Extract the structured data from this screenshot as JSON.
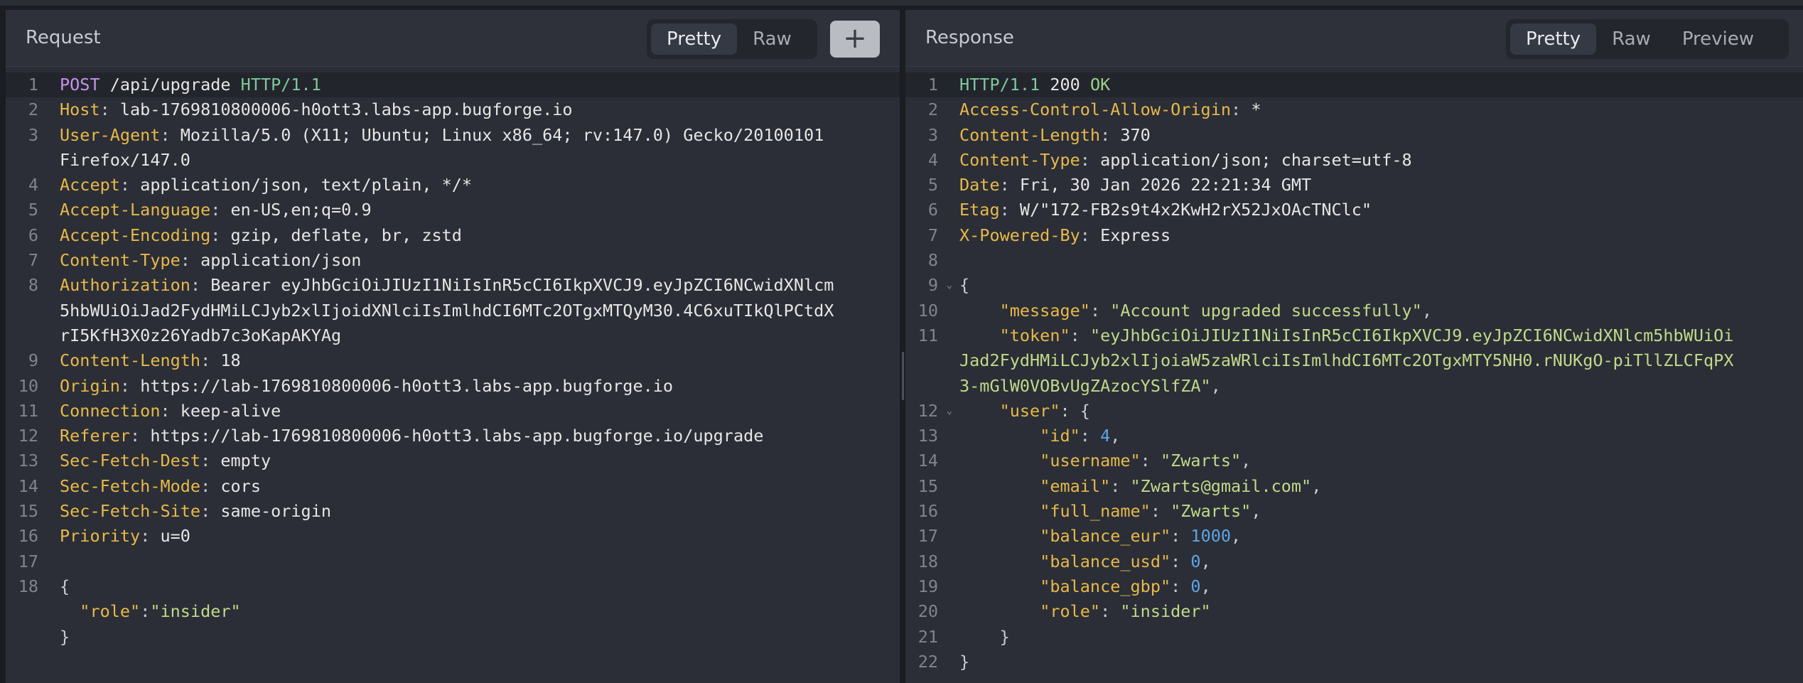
{
  "request": {
    "title": "Request",
    "tabs": [
      "Pretty",
      "Raw"
    ],
    "active_tab": "Pretty",
    "add_label": "+",
    "lines": [
      {
        "n": "1",
        "method": "POST",
        "path": " /api/upgrade ",
        "version": "HTTP/1.1"
      },
      {
        "n": "2",
        "key": "Host",
        "value": "lab-1769810800006-h0ott3.labs-app.bugforge.io"
      },
      {
        "n": "3",
        "key": "User-Agent",
        "value": "Mozilla/5.0 (X11; Ubuntu; Linux x86_64; rv:147.0) Gecko/20100101"
      },
      {
        "n": "",
        "cont": "Firefox/147.0"
      },
      {
        "n": "4",
        "key": "Accept",
        "value": "application/json, text/plain, */*"
      },
      {
        "n": "5",
        "key": "Accept-Language",
        "value": "en-US,en;q=0.9"
      },
      {
        "n": "6",
        "key": "Accept-Encoding",
        "value": "gzip, deflate, br, zstd"
      },
      {
        "n": "7",
        "key": "Content-Type",
        "value": "application/json"
      },
      {
        "n": "8",
        "key": "Authorization",
        "value": "Bearer eyJhbGciOiJIUzI1NiIsInR5cCI6IkpXVCJ9.eyJpZCI6NCwidXNlcm"
      },
      {
        "n": "",
        "cont": "5hbWUiOiJad2FydHMiLCJyb2xlIjoidXNlciIsImlhdCI6MTc2OTgxMTQyM30.4C6xuTIkQlPCtdX"
      },
      {
        "n": "",
        "cont": "rI5KfH3X0z26Yadb7c3oKapAKYAg"
      },
      {
        "n": "9",
        "key": "Content-Length",
        "value": "18"
      },
      {
        "n": "10",
        "key": "Origin",
        "value": "https://lab-1769810800006-h0ott3.labs-app.bugforge.io"
      },
      {
        "n": "11",
        "key": "Connection",
        "value": "keep-alive"
      },
      {
        "n": "12",
        "key": "Referer",
        "value": "https://lab-1769810800006-h0ott3.labs-app.bugforge.io/upgrade"
      },
      {
        "n": "13",
        "key": "Sec-Fetch-Dest",
        "value": "empty"
      },
      {
        "n": "14",
        "key": "Sec-Fetch-Mode",
        "value": "cors"
      },
      {
        "n": "15",
        "key": "Sec-Fetch-Site",
        "value": "same-origin"
      },
      {
        "n": "16",
        "key": "Priority",
        "value": "u=0"
      },
      {
        "n": "17",
        "raw": ""
      },
      {
        "n": "18",
        "raw": "{"
      },
      {
        "n": "",
        "body": [
          {
            "t": "  "
          },
          {
            "c": "jk",
            "t": "\"role\""
          },
          {
            "c": "p",
            "t": ":"
          },
          {
            "c": "js",
            "t": "\"insider\""
          }
        ]
      },
      {
        "n": "",
        "raw": "}"
      }
    ]
  },
  "response": {
    "title": "Response",
    "tabs": [
      "Pretty",
      "Raw",
      "Preview"
    ],
    "active_tab": "Pretty",
    "lines": [
      {
        "n": "1",
        "status": [
          {
            "c": "ver",
            "t": "HTTP/1.1"
          },
          {
            "c": "p",
            "t": " "
          },
          {
            "c": "nm-l",
            "t": "200"
          },
          {
            "c": "p",
            "t": " "
          },
          {
            "c": "st",
            "t": "OK"
          }
        ]
      },
      {
        "n": "2",
        "key": "Access-Control-Allow-Origin",
        "value": "*"
      },
      {
        "n": "3",
        "key": "Content-Length",
        "value": "370"
      },
      {
        "n": "4",
        "key": "Content-Type",
        "value": "application/json; charset=utf-8"
      },
      {
        "n": "5",
        "key": "Date",
        "value": "Fri, 30 Jan 2026 22:21:34 GMT"
      },
      {
        "n": "6",
        "key": "Etag",
        "value": "W/\"172-FB2s9t4x2KwH2rX52JxOAcTNClc\""
      },
      {
        "n": "7",
        "key": "X-Powered-By",
        "value": "Express"
      },
      {
        "n": "8",
        "raw": ""
      },
      {
        "n": "9",
        "fold": true,
        "raw": "{"
      },
      {
        "n": "10",
        "body": [
          {
            "t": "    "
          },
          {
            "c": "jk",
            "t": "\"message\""
          },
          {
            "c": "p",
            "t": ": "
          },
          {
            "c": "js",
            "t": "\"Account upgraded successfully\""
          },
          {
            "c": "p",
            "t": ","
          }
        ]
      },
      {
        "n": "11",
        "body": [
          {
            "t": "    "
          },
          {
            "c": "jk",
            "t": "\"token\""
          },
          {
            "c": "p",
            "t": ": "
          },
          {
            "c": "js",
            "t": "\"eyJhbGciOiJIUzI1NiIsInR5cCI6IkpXVCJ9.eyJpZCI6NCwidXNlcm5hbWUiOi"
          }
        ]
      },
      {
        "n": "",
        "body": [
          {
            "c": "js",
            "t": "Jad2FydHMiLCJyb2xlIjoiaW5zaWRlciIsImlhdCI6MTc2OTgxMTY5NH0.rNUKgO-piTllZLCFqPX"
          }
        ]
      },
      {
        "n": "",
        "body": [
          {
            "c": "js",
            "t": "3-mGlW0VOBvUgZAzocYSlfZA\""
          },
          {
            "c": "p",
            "t": ","
          }
        ]
      },
      {
        "n": "12",
        "fold": true,
        "body": [
          {
            "t": "    "
          },
          {
            "c": "jk",
            "t": "\"user\""
          },
          {
            "c": "p",
            "t": ": {"
          }
        ]
      },
      {
        "n": "13",
        "body": [
          {
            "t": "        "
          },
          {
            "c": "jk",
            "t": "\"id\""
          },
          {
            "c": "p",
            "t": ": "
          },
          {
            "c": "jn",
            "t": "4"
          },
          {
            "c": "p",
            "t": ","
          }
        ]
      },
      {
        "n": "14",
        "body": [
          {
            "t": "        "
          },
          {
            "c": "jk",
            "t": "\"username\""
          },
          {
            "c": "p",
            "t": ": "
          },
          {
            "c": "js",
            "t": "\"Zwarts\""
          },
          {
            "c": "p",
            "t": ","
          }
        ]
      },
      {
        "n": "15",
        "body": [
          {
            "t": "        "
          },
          {
            "c": "jk",
            "t": "\"email\""
          },
          {
            "c": "p",
            "t": ": "
          },
          {
            "c": "js",
            "t": "\"Zwarts@gmail.com\""
          },
          {
            "c": "p",
            "t": ","
          }
        ]
      },
      {
        "n": "16",
        "body": [
          {
            "t": "        "
          },
          {
            "c": "jk",
            "t": "\"full_name\""
          },
          {
            "c": "p",
            "t": ": "
          },
          {
            "c": "js",
            "t": "\"Zwarts\""
          },
          {
            "c": "p",
            "t": ","
          }
        ]
      },
      {
        "n": "17",
        "body": [
          {
            "t": "        "
          },
          {
            "c": "jk",
            "t": "\"balance_eur\""
          },
          {
            "c": "p",
            "t": ": "
          },
          {
            "c": "jn",
            "t": "1000"
          },
          {
            "c": "p",
            "t": ","
          }
        ]
      },
      {
        "n": "18",
        "body": [
          {
            "t": "        "
          },
          {
            "c": "jk",
            "t": "\"balance_usd\""
          },
          {
            "c": "p",
            "t": ": "
          },
          {
            "c": "jn",
            "t": "0"
          },
          {
            "c": "p",
            "t": ","
          }
        ]
      },
      {
        "n": "19",
        "body": [
          {
            "t": "        "
          },
          {
            "c": "jk",
            "t": "\"balance_gbp\""
          },
          {
            "c": "p",
            "t": ": "
          },
          {
            "c": "jn",
            "t": "0"
          },
          {
            "c": "p",
            "t": ","
          }
        ]
      },
      {
        "n": "20",
        "body": [
          {
            "t": "        "
          },
          {
            "c": "jk",
            "t": "\"role\""
          },
          {
            "c": "p",
            "t": ": "
          },
          {
            "c": "js",
            "t": "\"insider\""
          }
        ]
      },
      {
        "n": "21",
        "raw": "    }"
      },
      {
        "n": "22",
        "raw": "}"
      }
    ]
  },
  "colors": {
    "header_key": "#e8b94a",
    "method": "#c792ea",
    "http_version": "#7fc99b",
    "json_string": "#c3d98a",
    "json_number": "#5da5e6"
  },
  "icons": {
    "add": "plus-icon",
    "fold": "chevron-down-icon"
  }
}
